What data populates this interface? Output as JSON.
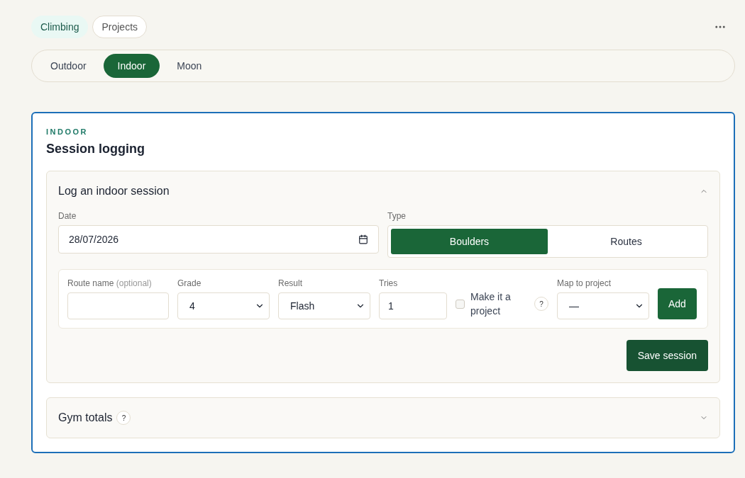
{
  "nav": [
    {
      "label": "Climbing",
      "selected": true
    },
    {
      "label": "Projects",
      "selected": false
    }
  ],
  "segments": [
    {
      "label": "Outdoor",
      "selected": false
    },
    {
      "label": "Indoor",
      "selected": true
    },
    {
      "label": "Moon",
      "selected": false
    }
  ],
  "card": {
    "eyebrow": "INDOOR",
    "title": "Session logging"
  },
  "log_section": {
    "title": "Log an indoor session",
    "expanded": true,
    "date": {
      "label": "Date",
      "value": "28/07/2026"
    },
    "type": {
      "label": "Type",
      "options": [
        {
          "label": "Boulders",
          "selected": true
        },
        {
          "label": "Routes",
          "selected": false
        }
      ]
    },
    "entry": {
      "route_name": {
        "label": "Route name",
        "hint": "(optional)"
      },
      "grade": {
        "label": "Grade",
        "value": "4"
      },
      "result": {
        "label": "Result",
        "value": "Flash"
      },
      "tries": {
        "label": "Tries",
        "value": "1"
      },
      "project": {
        "label": "Make it a project",
        "checked": false,
        "help": "?"
      },
      "map": {
        "label": "Map to project",
        "value": "—"
      },
      "add_button": "Add"
    },
    "save_button": "Save session"
  },
  "totals_section": {
    "title": "Gym totals",
    "help": "?",
    "expanded": false
  }
}
